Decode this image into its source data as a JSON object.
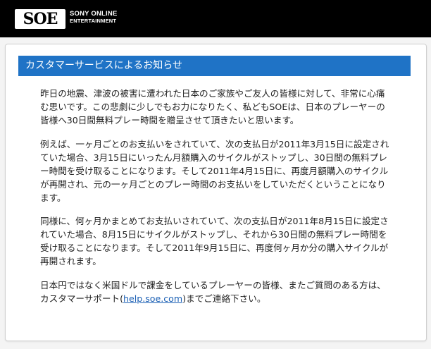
{
  "header": {
    "logo_text": "SOE",
    "brand_line1": "SONY ONLINE",
    "brand_line2": "ENTERTAINMENT"
  },
  "notice": {
    "title": "カスタマーサービスによるお知らせ",
    "paragraph1": "昨日の地震、津波の被害に遭われた日本のご家族やご友人の皆様に対して、非常に心痛む思いです。この悲劇に少しでもお力になりたく、私どもSOEは、日本のプレーヤーの皆様へ30日間無料プレー時間を贈呈させて頂きたいと思います。",
    "paragraph2": "例えば、一ヶ月ごとのお支払いをされていて、次の支払日が2011年3月15日に設定されていた場合、3月15日にいったん月額購入のサイクルがストップし、30日間の無料プレー時間を受け取ることになります。そして2011年4月15日に、再度月額購入のサイクルが再開され、元の一ヶ月ごとのプレー時間のお支払いをしていただくということになります。",
    "paragraph3": "同様に、何ヶ月かまとめてお支払いされていて、次の支払日が2011年8月15日に設定されていた場合、8月15日にサイクルがストップし、それから30日間の無料プレー時間を受け取ることになります。そして2011年9月15日に、再度何ヶ月か分の購入サイクルが再開されます。",
    "paragraph4_before": "日本円ではなく米国ドルで課金をしているプレーヤーの皆様、またご質問のある方は、カスタマーサポート(",
    "paragraph4_link": "help.soe.com",
    "paragraph4_after": ")までご連絡下さい。"
  }
}
